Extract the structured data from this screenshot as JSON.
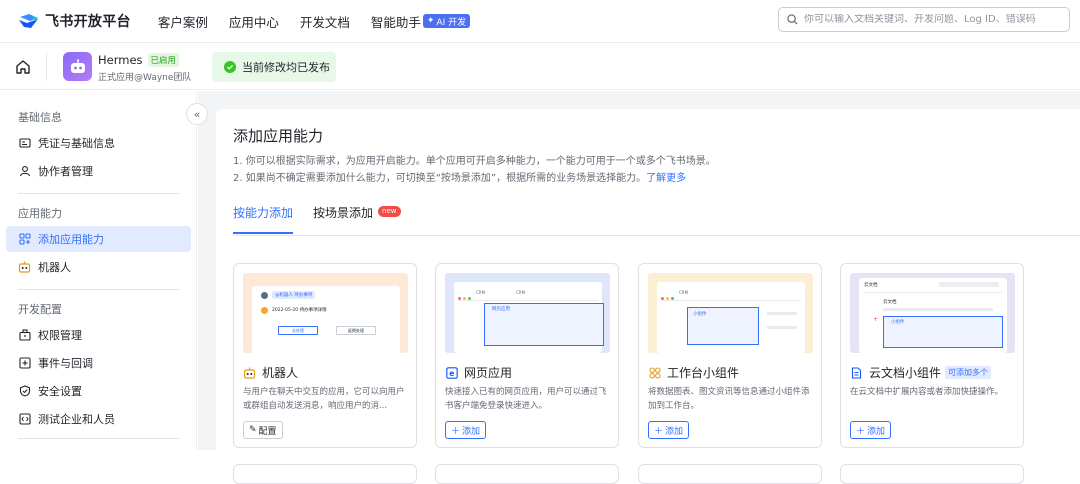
{
  "topbar": {
    "brand": "飞书开放平台",
    "nav": [
      "客户案例",
      "应用中心",
      "开发文档",
      "智能助手"
    ],
    "ai_badge": "AI 开发",
    "search_placeholder": "你可以输入文档关键词、开发问题、Log ID、错误码"
  },
  "app": {
    "name": "Hermes",
    "status": "已启用",
    "subtitle": "正式应用@Wayne团队",
    "publish_status": "当前修改均已发布"
  },
  "sidebar": {
    "sections": [
      {
        "title": "基础信息",
        "items": [
          "凭证与基础信息",
          "协作者管理"
        ]
      },
      {
        "title": "应用能力",
        "items": [
          "添加应用能力",
          "机器人"
        ]
      },
      {
        "title": "开发配置",
        "items": [
          "权限管理",
          "事件与回调",
          "安全设置",
          "测试企业和人员"
        ]
      }
    ],
    "active_item": "添加应用能力"
  },
  "main": {
    "title": "添加应用能力",
    "desc1": "1. 你可以根据实际需求，为应用开启能力。单个应用可开启多种能力，一个能力可用于一个或多个飞书场景。",
    "desc2": "2. 如果尚不确定需要添加什么能力，可切换至“按场景添加”，根据所需的业务场景选择能力。",
    "learn_more": "了解更多",
    "tabs": [
      "按能力添加",
      "按场景添加"
    ],
    "new_badge": "new",
    "cards": [
      {
        "title": "机器人",
        "desc": "与用户在聊天中交互的应用，它可以向用户或群组自动发送消息，响应用户的消...",
        "button": "配置",
        "icon": "robot-icon"
      },
      {
        "title": "网页应用",
        "desc": "快速接入已有的网页应用，用户可以通过飞书客户端免登录快速进入。",
        "button": "添加",
        "icon": "web-app-icon"
      },
      {
        "title": "工作台小组件",
        "desc": "将数据图表、图文资讯等信息通过小组件添加到工作台。",
        "button": "添加",
        "icon": "widget-icon"
      },
      {
        "title": "云文档小组件",
        "desc": "在云文档中扩展内容或者添加快捷操作。",
        "button": "添加",
        "tag": "可添加多个",
        "icon": "doc-widget-icon"
      }
    ],
    "thumbs": {
      "robot_bubble": "@机器人 待办事项",
      "robot_date": "2022-05-20 待办事项详情",
      "robot_btn1": "去处理",
      "robot_btn2": "延期处理",
      "web_tab1": "CRM",
      "web_tab2": "CRM",
      "web_app": "网页应用",
      "work_tab": "CRM",
      "work_widget": "小组件",
      "doc_header": "云文档",
      "doc_title": "云文档",
      "doc_widget": "小组件"
    }
  },
  "colors": {
    "accent": "#3370ff",
    "success": "#34c724",
    "sidebar_active_bg": "#e1eaff"
  }
}
